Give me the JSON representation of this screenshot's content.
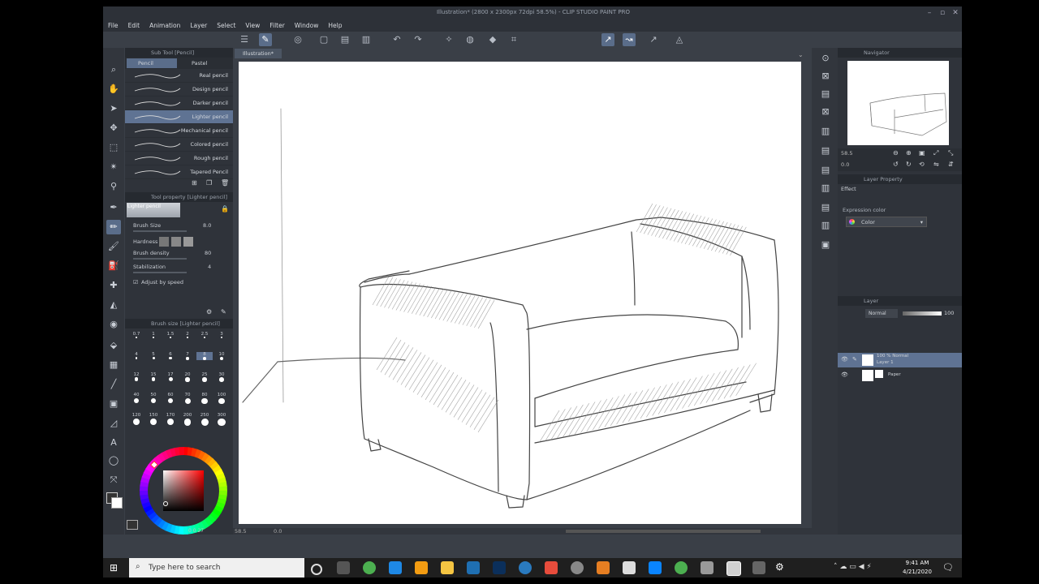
{
  "window": {
    "title": "Illustration* (2800 x 2300px 72dpi 58.5%) - CLIP STUDIO PAINT PRO"
  },
  "menu": [
    "File",
    "Edit",
    "Animation",
    "Layer",
    "Select",
    "View",
    "Filter",
    "Window",
    "Help"
  ],
  "doc_tab": "Illustration*",
  "subtool": {
    "panel_title": "Sub Tool [Pencil]",
    "tabs": [
      "Pencil",
      "Pastel"
    ],
    "brushes": [
      "Real pencil",
      "Design pencil",
      "Darker pencil",
      "Lighter pencil",
      "Mechanical pencil",
      "Colored pencil",
      "Rough pencil",
      "Tapered Pencil"
    ],
    "selected": "Lighter pencil"
  },
  "tool_property": {
    "panel_title": "Tool property [Lighter pencil]",
    "preview_label": "Lighter pencil",
    "brush_size_label": "Brush Size",
    "brush_size_value": "8.0",
    "hardness_label": "Hardness",
    "density_label": "Brush density",
    "density_value": "80",
    "stabilization_label": "Stabilization",
    "stabilization_value": "4",
    "adjust_label": "Adjust by speed",
    "adjust_checked": true
  },
  "brush_size_panel": {
    "panel_title": "Brush size [Lighter pencil]",
    "sizes": [
      "0.7",
      "1",
      "1.5",
      "2",
      "2.5",
      "3",
      "4",
      "5",
      "6",
      "7",
      "8",
      "10",
      "12",
      "15",
      "17",
      "20",
      "25",
      "30",
      "40",
      "50",
      "60",
      "70",
      "80",
      "100",
      "120",
      "150",
      "170",
      "200",
      "250",
      "300"
    ],
    "selected": "8"
  },
  "color": {
    "main_hue": "#ff0000",
    "hsv_readout": "0  0  27"
  },
  "status": {
    "zoom": "58.5",
    "rotation": "0.0"
  },
  "navigator": {
    "panel_title": "Navigator",
    "zoom_value": "58.5",
    "rotate_value": "0.0"
  },
  "layer_property": {
    "panel_title": "Layer Property",
    "effect_label": "Effect",
    "expression_label": "Expression color",
    "expression_value": "Color"
  },
  "layers": {
    "panel_title": "Layer",
    "blend_mode": "Normal",
    "opacity": "100",
    "items": [
      {
        "percent": "100 % Normal",
        "name": "Layer 1",
        "selected": true
      },
      {
        "percent": "",
        "name": "Paper",
        "selected": false
      }
    ]
  },
  "taskbar": {
    "search_placeholder": "Type here to search",
    "time": "9:41 AM",
    "date": "4/21/2020"
  }
}
